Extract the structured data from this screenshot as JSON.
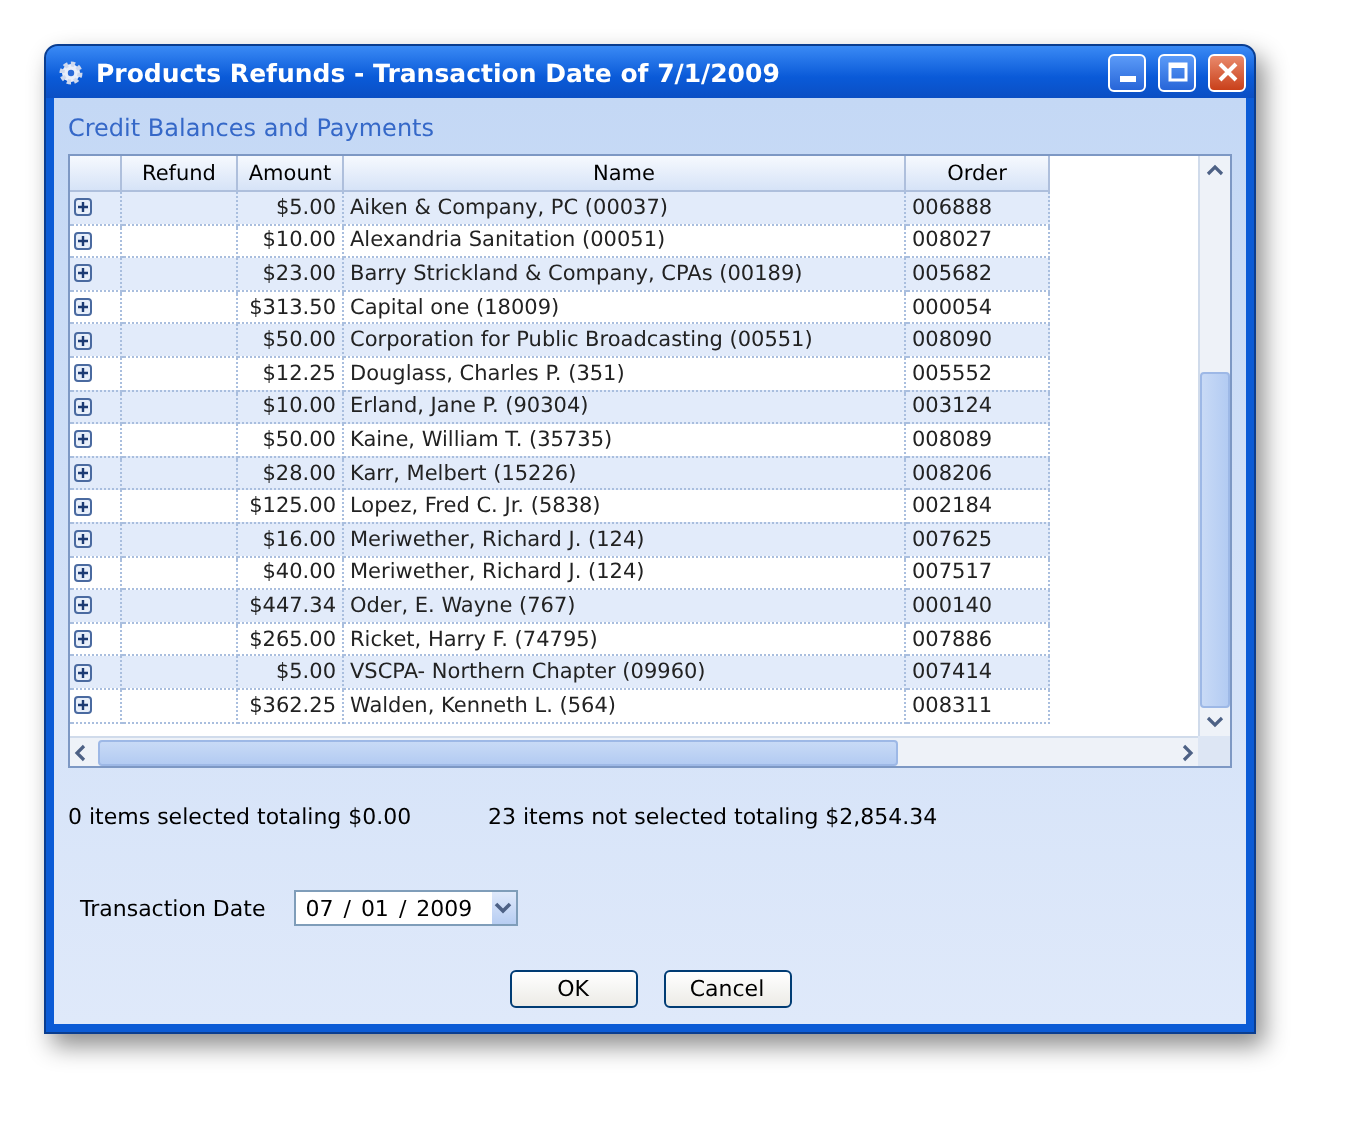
{
  "window": {
    "title": "Products Refunds - Transaction Date of 7/1/2009"
  },
  "section_title": "Credit Balances and Payments",
  "table": {
    "columns": [
      "Refund",
      "Amount",
      "Name",
      "Order"
    ],
    "rows": [
      {
        "amount": "$5.00",
        "name": "Aiken & Company, PC (00037)",
        "order": "006888"
      },
      {
        "amount": "$10.00",
        "name": "Alexandria Sanitation (00051)",
        "order": "008027"
      },
      {
        "amount": "$23.00",
        "name": "Barry Strickland & Company, CPAs (00189)",
        "order": "005682"
      },
      {
        "amount": "$313.50",
        "name": "Capital one (18009)",
        "order": "000054"
      },
      {
        "amount": "$50.00",
        "name": "Corporation for Public Broadcasting (00551)",
        "order": "008090"
      },
      {
        "amount": "$12.25",
        "name": "Douglass, Charles P. (351)",
        "order": "005552"
      },
      {
        "amount": "$10.00",
        "name": "Erland, Jane P. (90304)",
        "order": "003124"
      },
      {
        "amount": "$50.00",
        "name": "Kaine, William T. (35735)",
        "order": "008089"
      },
      {
        "amount": "$28.00",
        "name": "Karr, Melbert (15226)",
        "order": "008206"
      },
      {
        "amount": "$125.00",
        "name": "Lopez, Fred C. Jr. (5838)",
        "order": "002184"
      },
      {
        "amount": "$16.00",
        "name": "Meriwether, Richard J. (124)",
        "order": "007625"
      },
      {
        "amount": "$40.00",
        "name": "Meriwether, Richard J. (124)",
        "order": "007517"
      },
      {
        "amount": "$447.34",
        "name": "Oder, E. Wayne (767)",
        "order": "000140"
      },
      {
        "amount": "$265.00",
        "name": "Ricket, Harry F. (74795)",
        "order": "007886"
      },
      {
        "amount": "$5.00",
        "name": "VSCPA- Northern Chapter (09960)",
        "order": "007414"
      },
      {
        "amount": "$362.25",
        "name": "Walden, Kenneth L. (564)",
        "order": "008311"
      }
    ]
  },
  "summary": {
    "selected": "0 items selected totaling $0.00",
    "not_selected": "23 items not selected totaling $2,854.34"
  },
  "transaction_date": {
    "label": "Transaction Date",
    "month": "07",
    "day": "01",
    "year": "2009",
    "separator": "/"
  },
  "buttons": [
    "OK",
    "Cancel"
  ]
}
